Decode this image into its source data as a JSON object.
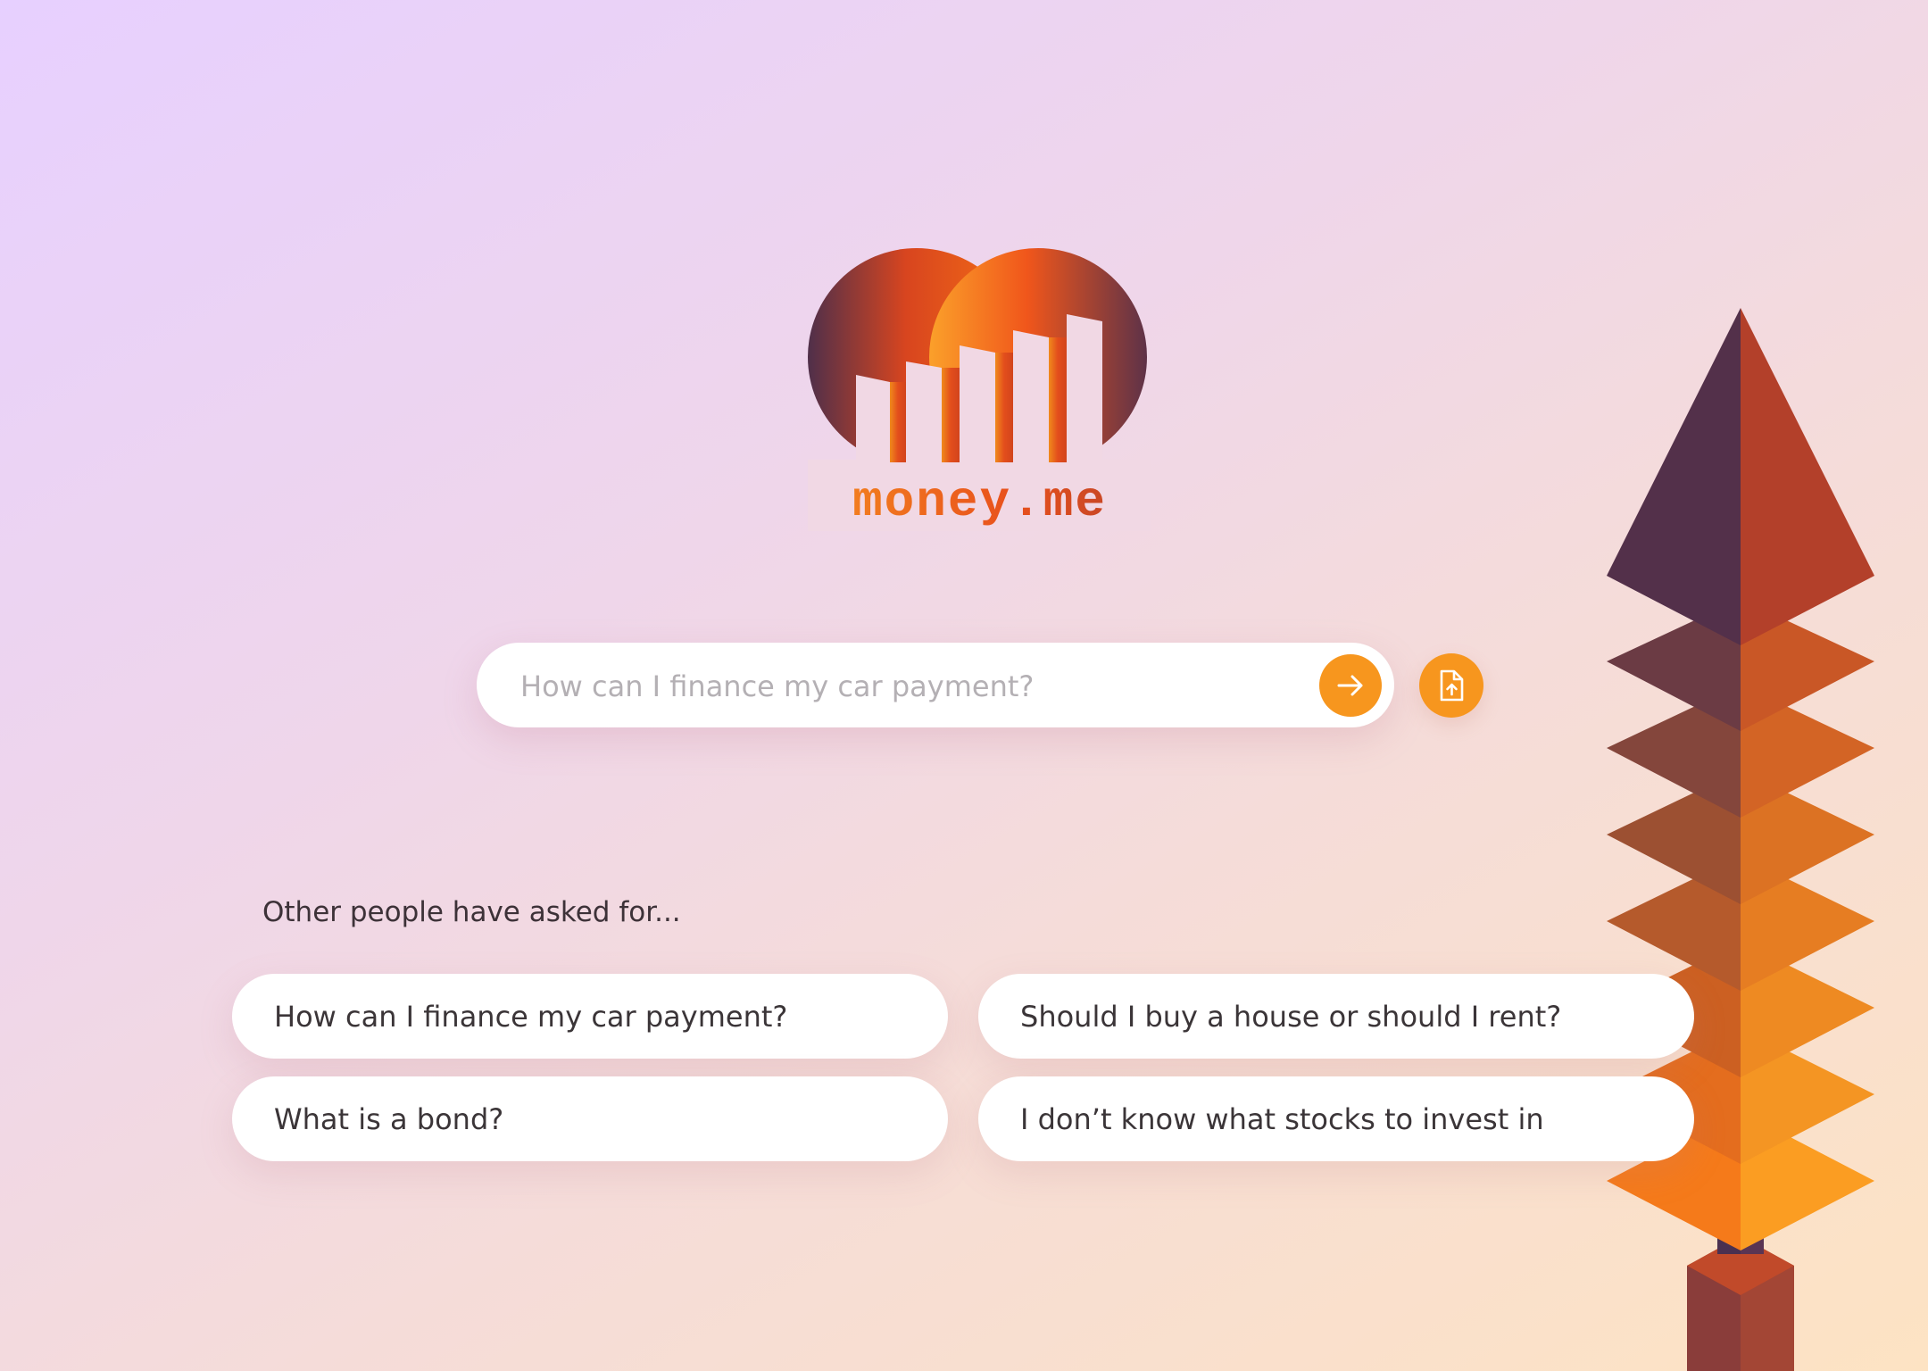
{
  "brand": {
    "name": "money.me",
    "colors": {
      "orange": "#f7961e",
      "red_orange": "#e8501c",
      "deep_purple": "#4f2f4a"
    }
  },
  "search": {
    "placeholder": "How can I finance my car payment?",
    "submit_icon": "arrow-right-icon",
    "upload_icon": "file-upload-icon"
  },
  "suggestions": {
    "title": "Other people have asked for...",
    "items": [
      {
        "label": "How can I finance my car payment?"
      },
      {
        "label": "Should I buy a house or should I rent?"
      },
      {
        "label": "What is a bond?"
      },
      {
        "label": "I don’t know what stocks to invest in"
      }
    ]
  },
  "decoration": {
    "illustration": "layered-arrow-tree"
  }
}
